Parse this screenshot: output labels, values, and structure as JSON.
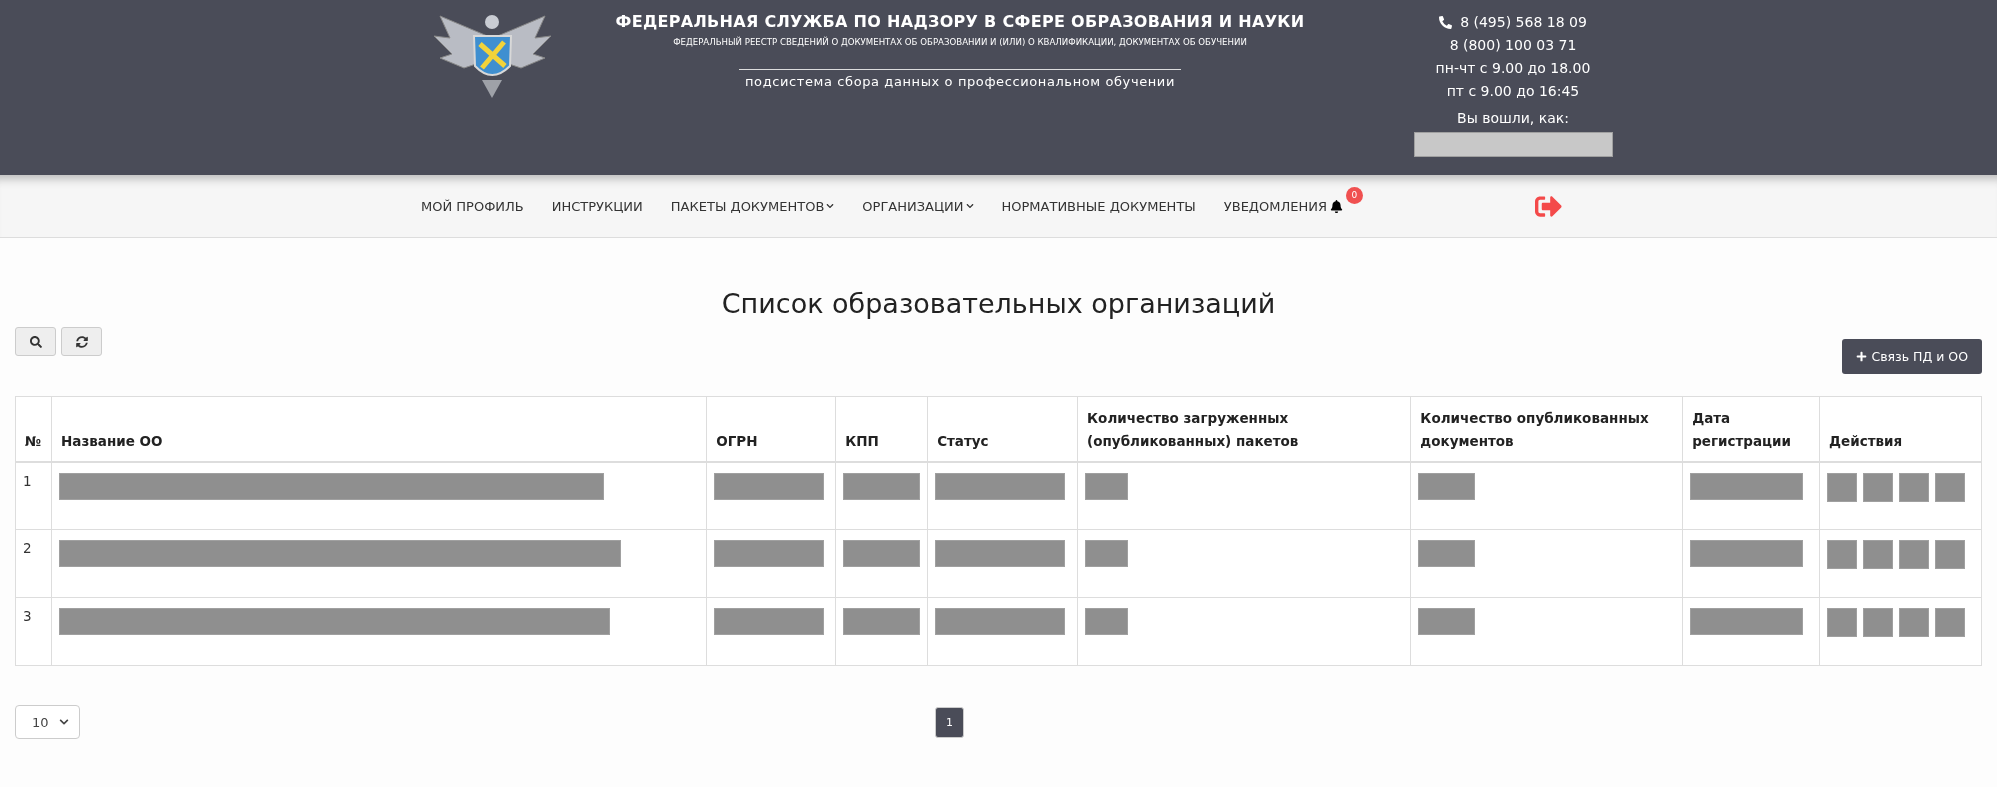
{
  "header": {
    "title": "ФЕДЕРАЛЬНАЯ СЛУЖБА ПО НАДЗОРУ В СФЕРЕ ОБРАЗОВАНИЯ И НАУКИ",
    "subtitle": "ФЕДЕРАЛЬНЫЙ РЕЕСТР СВЕДЕНИЙ О ДОКУМЕНТАХ ОБ ОБРАЗОВАНИИ И (ИЛИ) О КВАЛИФИКАЦИИ, ДОКУМЕНТАХ ОБ ОБУЧЕНИИ",
    "subsystem": "подсистема сбора данных о профессиональном обучении",
    "contacts": {
      "phone_1": "8 (495) 568 18 09",
      "phone_2": "8 (800) 100 03 71",
      "hours_1": "пн-чт с 9.00 до 18.00",
      "hours_2": "пт с 9.00 до 16:45",
      "logged_in_as": "Вы вошли, как:"
    }
  },
  "nav": {
    "items": [
      {
        "label": "МОЙ ПРОФИЛЬ",
        "dropdown": false
      },
      {
        "label": "ИНСТРУКЦИИ",
        "dropdown": false
      },
      {
        "label": "ПАКЕТЫ ДОКУМЕНТОВ",
        "dropdown": true
      },
      {
        "label": "ОРГАНИЗАЦИИ",
        "dropdown": true
      },
      {
        "label": "НОРМАТИВНЫЕ ДОКУМЕНТЫ",
        "dropdown": false
      },
      {
        "label": "УВЕДОМЛЕНИЯ",
        "dropdown": false,
        "badge": "0"
      }
    ]
  },
  "page_title": "Список образовательных организаций",
  "link_button": "Связь ПД и ОО",
  "table": {
    "columns": [
      "№",
      "Название ОО",
      "ОГРН",
      "КПП",
      "Статус",
      "Количество загруженных (опубликованных) пакетов",
      "Количество опубликованных документов",
      "Дата регистрации",
      "Действия"
    ],
    "rows": [
      {
        "number": "1"
      },
      {
        "number": "2"
      },
      {
        "number": "3"
      }
    ]
  },
  "page_size": "10",
  "pagination": [
    {
      "label": "1",
      "selected": true
    }
  ]
}
